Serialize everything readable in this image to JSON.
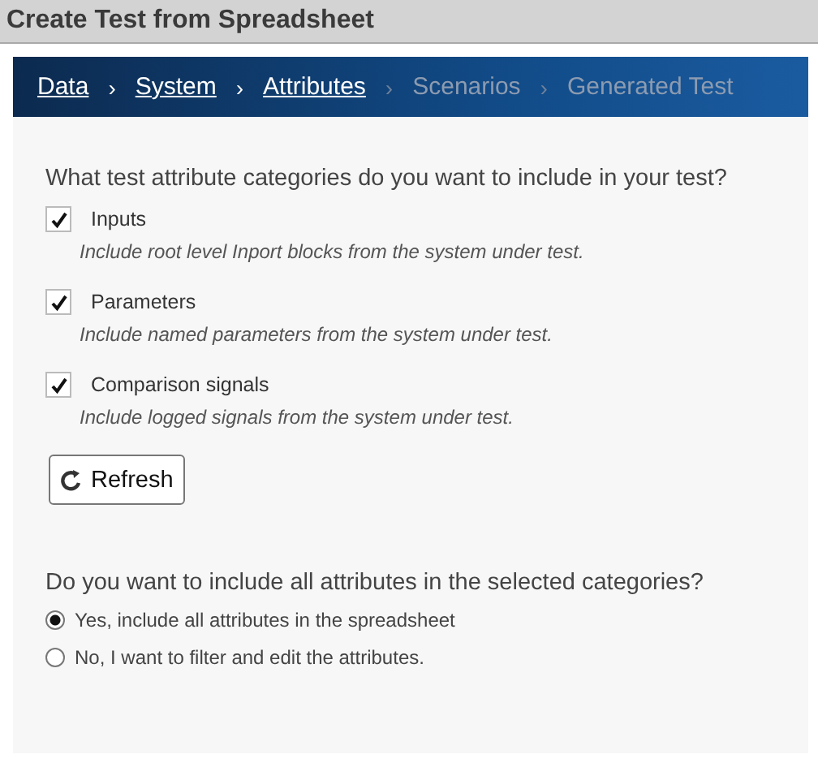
{
  "window": {
    "title": "Create Test from Spreadsheet"
  },
  "breadcrumb": [
    {
      "label": "Data",
      "completed": true
    },
    {
      "separator": "›",
      "label": "System",
      "completed": true
    },
    {
      "separator": "›",
      "label": "Attributes",
      "completed": true
    },
    {
      "separator": "›",
      "label": "Scenarios",
      "completed": false
    },
    {
      "separator": "›",
      "label": "Generated Test",
      "completed": false
    }
  ],
  "categories_question": "What test attribute categories do you want to include in your test?",
  "categories": [
    {
      "label": "Inputs",
      "description": "Include root level Inport blocks from the system under test.",
      "checked": true
    },
    {
      "label": "Parameters",
      "description": "Include named parameters from the system under test.",
      "checked": true
    },
    {
      "label": "Comparison signals",
      "description": "Include logged signals from the system under test.",
      "checked": true
    }
  ],
  "refresh_button": {
    "label": "Refresh"
  },
  "include_question": "Do you want to include all attributes in the selected categories?",
  "include_options": [
    {
      "label": "Yes, include all attributes in the spreadsheet",
      "selected": true
    },
    {
      "label": "No, I want to filter and edit the attributes.",
      "selected": false
    }
  ]
}
